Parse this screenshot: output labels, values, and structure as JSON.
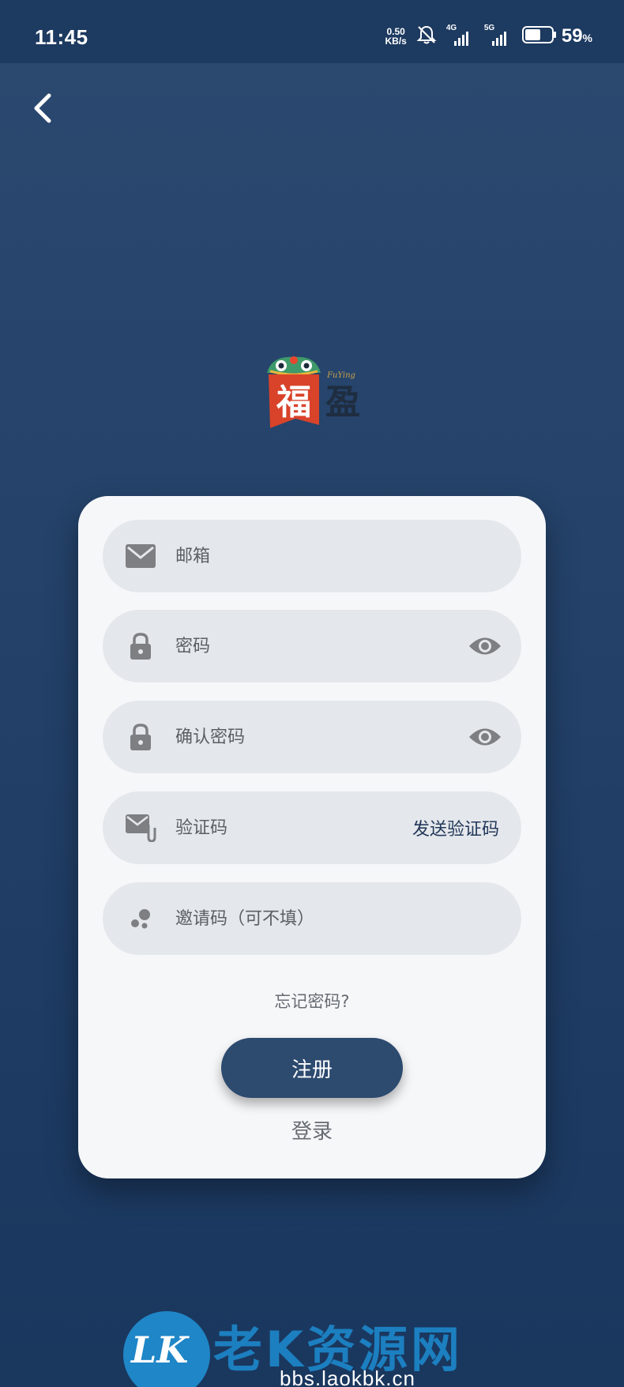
{
  "status_bar": {
    "time": "11:45",
    "net_speed_value": "0.50",
    "net_speed_unit": "KB/s",
    "signal1_tag": "4G",
    "signal2_tag": "5G",
    "battery_percent": "59",
    "battery_unit": "%",
    "battery_level": 0.59
  },
  "form": {
    "email_placeholder": "邮箱",
    "password_placeholder": "密码",
    "confirm_password_placeholder": "确认密码",
    "code_placeholder": "验证码",
    "send_code_label": "发送验证码",
    "invite_placeholder": "邀请码（可不填）",
    "forgot_label": "忘记密码?",
    "register_label": "注册",
    "login_label": "登录"
  },
  "logo": {
    "char1": "福",
    "char2": "盈",
    "small_text": "FuYing"
  },
  "watermark": {
    "badge": "LK",
    "title": "老K资源网",
    "url": "bbs.laokbk.cn"
  },
  "colors": {
    "background": "#24426a",
    "card": "#f6f7f9",
    "field": "#e4e7eb",
    "primary_button": "#2d4a6f",
    "icon": "#7d7f83",
    "watermark_blue": "#1c7fc0"
  },
  "icons": {
    "back": "chevron-left-icon",
    "email": "mail-icon",
    "password": "lock-icon",
    "eye": "eye-icon",
    "code": "mail-attachment-icon",
    "invite": "dots-icon"
  }
}
